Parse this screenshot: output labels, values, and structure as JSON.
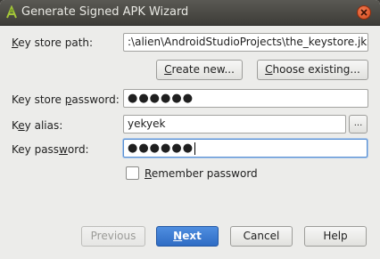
{
  "window": {
    "title": "Generate Signed APK Wizard",
    "icon": "android-studio-icon",
    "close_icon": "close-icon"
  },
  "form": {
    "key_store_path": {
      "label_pre": "",
      "label_mnemonic": "K",
      "label_post": "ey store path:",
      "value": ":\\alien\\AndroidStudioProjects\\the_keystore.jks"
    },
    "create_new_button": {
      "pre": "",
      "mnemonic": "C",
      "post": "reate new..."
    },
    "choose_existing_button": {
      "pre": "",
      "mnemonic": "C",
      "post": "hoose existing..."
    },
    "key_store_password": {
      "label_pre": "Key store ",
      "label_mnemonic": "p",
      "label_post": "assword:",
      "value": "●●●●●●"
    },
    "key_alias": {
      "label_pre": "K",
      "label_mnemonic": "e",
      "label_post": "y alias:",
      "value": "yekyek",
      "browse_label": "..."
    },
    "key_password": {
      "label_pre": "Key pass",
      "label_mnemonic": "w",
      "label_post": "ord:",
      "value": "●●●●●●"
    },
    "remember_password": {
      "checked": false,
      "label_pre": "",
      "label_mnemonic": "R",
      "label_post": "emember password"
    }
  },
  "footer": {
    "previous_label": "Previous",
    "next_pre": "",
    "next_mnemonic": "N",
    "next_post": "ext",
    "cancel_label": "Cancel",
    "help_label": "Help"
  },
  "colors": {
    "titlebar": "#3d3c38",
    "window_bg": "#ececea",
    "primary_button": "#2f6cc4",
    "close_button": "#d44a1b",
    "focus_ring": "#5a91d4"
  }
}
